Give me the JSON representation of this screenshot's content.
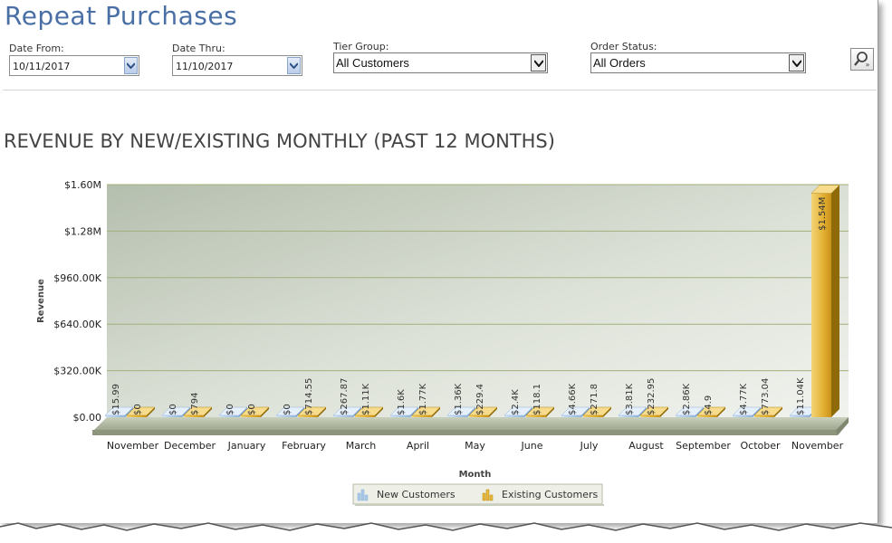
{
  "page": {
    "title": "Repeat Purchases"
  },
  "filters": {
    "date_from": {
      "label": "Date From:",
      "value": "10/11/2017"
    },
    "date_thru": {
      "label": "Date Thru:",
      "value": "11/10/2017"
    },
    "tier_group": {
      "label": "Tier Group:",
      "value": "All Customers"
    },
    "order_status": {
      "label": "Order Status:",
      "value": "All Orders"
    }
  },
  "icons": {
    "search": "search-magnifier-icon",
    "calendar": "calendar-dropdown-icon",
    "select": "chevron-down-icon"
  },
  "chart_data": {
    "type": "bar",
    "title": "REVENUE BY NEW/EXISTING MONTHLY (PAST 12 MONTHS)",
    "xlabel": "Month",
    "ylabel": "Revenue",
    "ylim": [
      0,
      1600000
    ],
    "yticks": [
      0,
      320000,
      640000,
      960000,
      1280000,
      1600000
    ],
    "ytick_labels": [
      "$0.00",
      "$320.00K",
      "$640.00K",
      "$960.00K",
      "$1.28M",
      "$1.60M"
    ],
    "categories": [
      "November",
      "December",
      "January",
      "February",
      "March",
      "April",
      "May",
      "June",
      "July",
      "August",
      "September",
      "October",
      "November"
    ],
    "series": [
      {
        "name": "New Customers",
        "color": "#a9c8e8",
        "values": [
          15.99,
          0,
          0,
          0,
          267.87,
          1600,
          1360,
          2400,
          4660,
          3810,
          2860,
          4770,
          11040
        ],
        "labels": [
          "$15.99",
          "$0",
          "$0",
          "$0",
          "$267.87",
          "$1.6K",
          "$1.36K",
          "$2.4K",
          "$4.66K",
          "$3.81K",
          "$2.86K",
          "$4.77K",
          "$11.04K"
        ]
      },
      {
        "name": "Existing Customers",
        "color": "#e8b93a",
        "values": [
          0,
          794,
          0,
          714.55,
          1110,
          1770,
          229.4,
          118.1,
          271.8,
          232.95,
          4.9,
          773.04,
          1540000
        ],
        "labels": [
          "$0",
          "$794",
          "$0",
          "$714.55",
          "$1.11K",
          "$1.77K",
          "$229.4",
          "$118.1",
          "$271.8",
          "$232.95",
          "$4.9",
          "$773.04",
          "$1.54M"
        ]
      }
    ],
    "grid": true,
    "legend": "bottom-center"
  }
}
